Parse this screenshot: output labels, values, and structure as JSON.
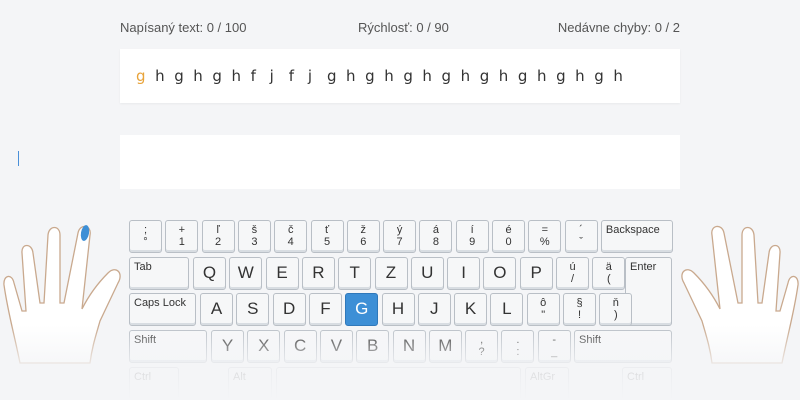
{
  "stats": {
    "typed": "Napísaný text: 0 / 100",
    "speed": "Rýchlosť: 0 / 90",
    "errors": "Nedávne chyby: 0 / 2"
  },
  "target_text": [
    "g",
    "h",
    "g",
    "h",
    "g",
    "h",
    "f",
    "j",
    "f",
    "j",
    "g",
    "h",
    "g",
    "h",
    "g",
    "h",
    "g",
    "h",
    "g",
    "h",
    "g",
    "h",
    "g",
    "h",
    "g",
    "h"
  ],
  "current_index": 0,
  "input": {
    "value": ""
  },
  "keyboard": {
    "row1": [
      {
        "top": ";",
        "bottom": "°"
      },
      {
        "top": "+",
        "bottom": "1"
      },
      {
        "top": "ľ",
        "bottom": "2"
      },
      {
        "top": "š",
        "bottom": "3"
      },
      {
        "top": "č",
        "bottom": "4"
      },
      {
        "top": "ť",
        "bottom": "5"
      },
      {
        "top": "ž",
        "bottom": "6"
      },
      {
        "top": "ý",
        "bottom": "7"
      },
      {
        "top": "á",
        "bottom": "8"
      },
      {
        "top": "í",
        "bottom": "9"
      },
      {
        "top": "é",
        "bottom": "0"
      },
      {
        "top": "=",
        "bottom": "%"
      },
      {
        "top": "´",
        "bottom": "ˇ"
      }
    ],
    "backspace": "Backspace",
    "tab": "Tab",
    "row2": [
      "Q",
      "W",
      "E",
      "R",
      "T",
      "Z",
      "U",
      "I",
      "O",
      "P"
    ],
    "row2_sym": [
      {
        "top": "ú",
        "bottom": "/"
      },
      {
        "top": "ä",
        "bottom": "("
      }
    ],
    "enter": "Enter",
    "caps": "Caps Lock",
    "row3": [
      "A",
      "S",
      "D",
      "F",
      "G",
      "H",
      "J",
      "K",
      "L"
    ],
    "row3_sym": [
      {
        "top": "ô",
        "bottom": "\""
      },
      {
        "top": "§",
        "bottom": "!"
      },
      {
        "top": "ň",
        "bottom": ")"
      }
    ],
    "shift_left": "Shift",
    "row4": [
      "Y",
      "X",
      "C",
      "V",
      "B",
      "N",
      "M"
    ],
    "row4_sym": [
      {
        "top": ",",
        "bottom": "?"
      },
      {
        "top": ".",
        "bottom": ":"
      },
      {
        "top": "-",
        "bottom": "_"
      }
    ],
    "shift_right": "Shift",
    "ctrl_left": "Ctrl",
    "alt_left": "Alt",
    "altgr": "AltGr",
    "ctrl_right": "Ctrl",
    "active_key": "G"
  }
}
